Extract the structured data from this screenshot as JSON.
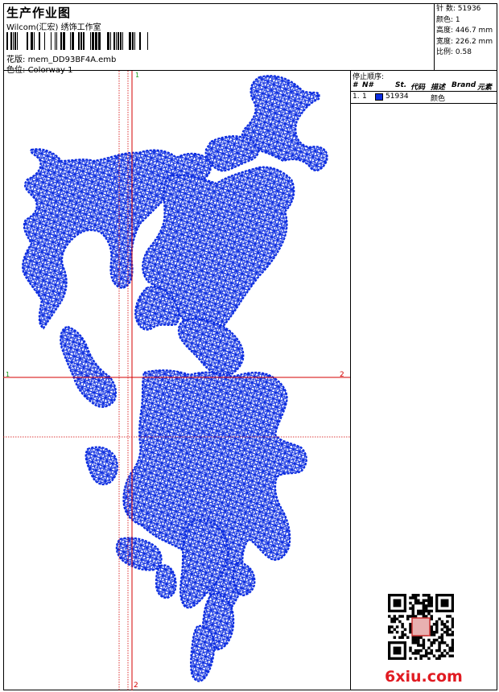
{
  "header": {
    "title": "生产作业图",
    "company": "Wilcom(汇宏) 绣饰工作室",
    "design_label": "花版:",
    "design_value": "mem_DD93BF4A.emb",
    "colorway_label": "色位:",
    "colorway_value": "Colorway 1"
  },
  "stats": {
    "stitches_label": "针 数:",
    "stitches_value": "51936",
    "colors_label": "颜色:",
    "colors_value": "1",
    "height_label": "高度:",
    "height_value": "446.7 mm",
    "width_label": "宽度:",
    "width_value": "226.2 mm",
    "scale_label": "比例:",
    "scale_value": "0.58"
  },
  "stop_sequence": {
    "title": "停止顺序:",
    "columns": [
      "#",
      "N#",
      "St.",
      "代码",
      "描述",
      "Brand",
      "元素"
    ],
    "rows": [
      {
        "index": "1.",
        "needle": "1",
        "stitches": "51934",
        "color": "#0b2ce0",
        "description": "颜色"
      }
    ]
  },
  "canvas": {
    "guide_v_start": "1",
    "guide_v_end": "2",
    "guide_h_start": "1",
    "guide_h_end": "2",
    "thread_color": "#0b2ce0",
    "guide_color": "#d40000"
  },
  "footer": {
    "site_logo": "6xiu.com"
  }
}
